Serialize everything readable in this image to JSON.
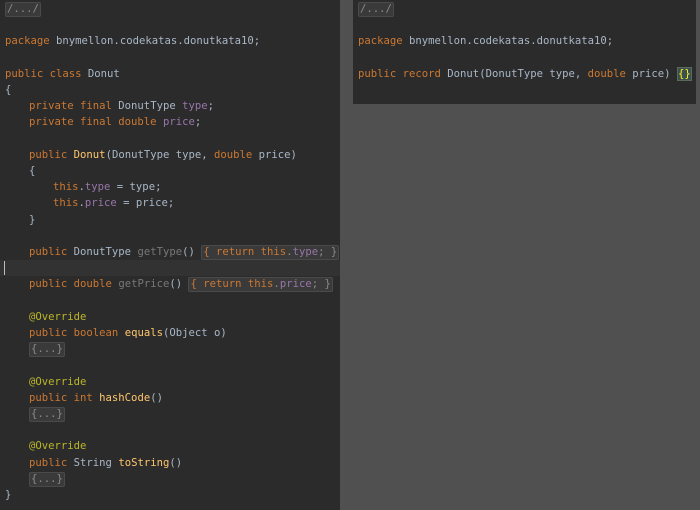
{
  "left_pane": {
    "lines": [
      [
        "/.../"
      ],
      [],
      [
        "package",
        " bnymellon.codekatas.donutkata10;"
      ],
      [],
      [
        "public class",
        " Donut"
      ],
      [
        "{"
      ],
      [
        "private final",
        " DonutType ",
        "type",
        ";"
      ],
      [
        "private final double",
        " ",
        "price",
        ";"
      ],
      [],
      [
        "public",
        " ",
        "Donut",
        "(DonutType type, ",
        "double",
        " price)"
      ],
      [
        "{"
      ],
      [
        "this",
        ".",
        "type",
        " = type;"
      ],
      [
        "this",
        ".",
        "price",
        " = price;"
      ],
      [
        "}"
      ],
      [],
      [
        "public",
        " DonutType ",
        "getType",
        "() ",
        "{ ",
        "return this",
        ".",
        "type",
        "; ",
        "}"
      ],
      [],
      [
        "public double",
        " ",
        "getPrice",
        "() ",
        "{ ",
        "return this",
        ".",
        "price",
        "; ",
        "}"
      ],
      [],
      [
        "@Override"
      ],
      [
        "public boolean",
        " ",
        "equals",
        "(Object o)"
      ],
      [
        "{...}"
      ],
      [],
      [
        "@Override"
      ],
      [
        "public int",
        " ",
        "hashCode",
        "()"
      ],
      [
        "{...}"
      ],
      [],
      [
        "@Override"
      ],
      [
        "public",
        " String ",
        "toString",
        "()"
      ],
      [
        "{...}"
      ],
      [
        "}"
      ]
    ]
  },
  "right_pane": {
    "lines": [
      [
        "/.../"
      ],
      [],
      [
        "package",
        " bnymellon.codekatas.donutkata10;"
      ],
      [],
      [
        "public record",
        " Donut(DonutType type, ",
        "double",
        " price) ",
        "{}"
      ]
    ]
  }
}
